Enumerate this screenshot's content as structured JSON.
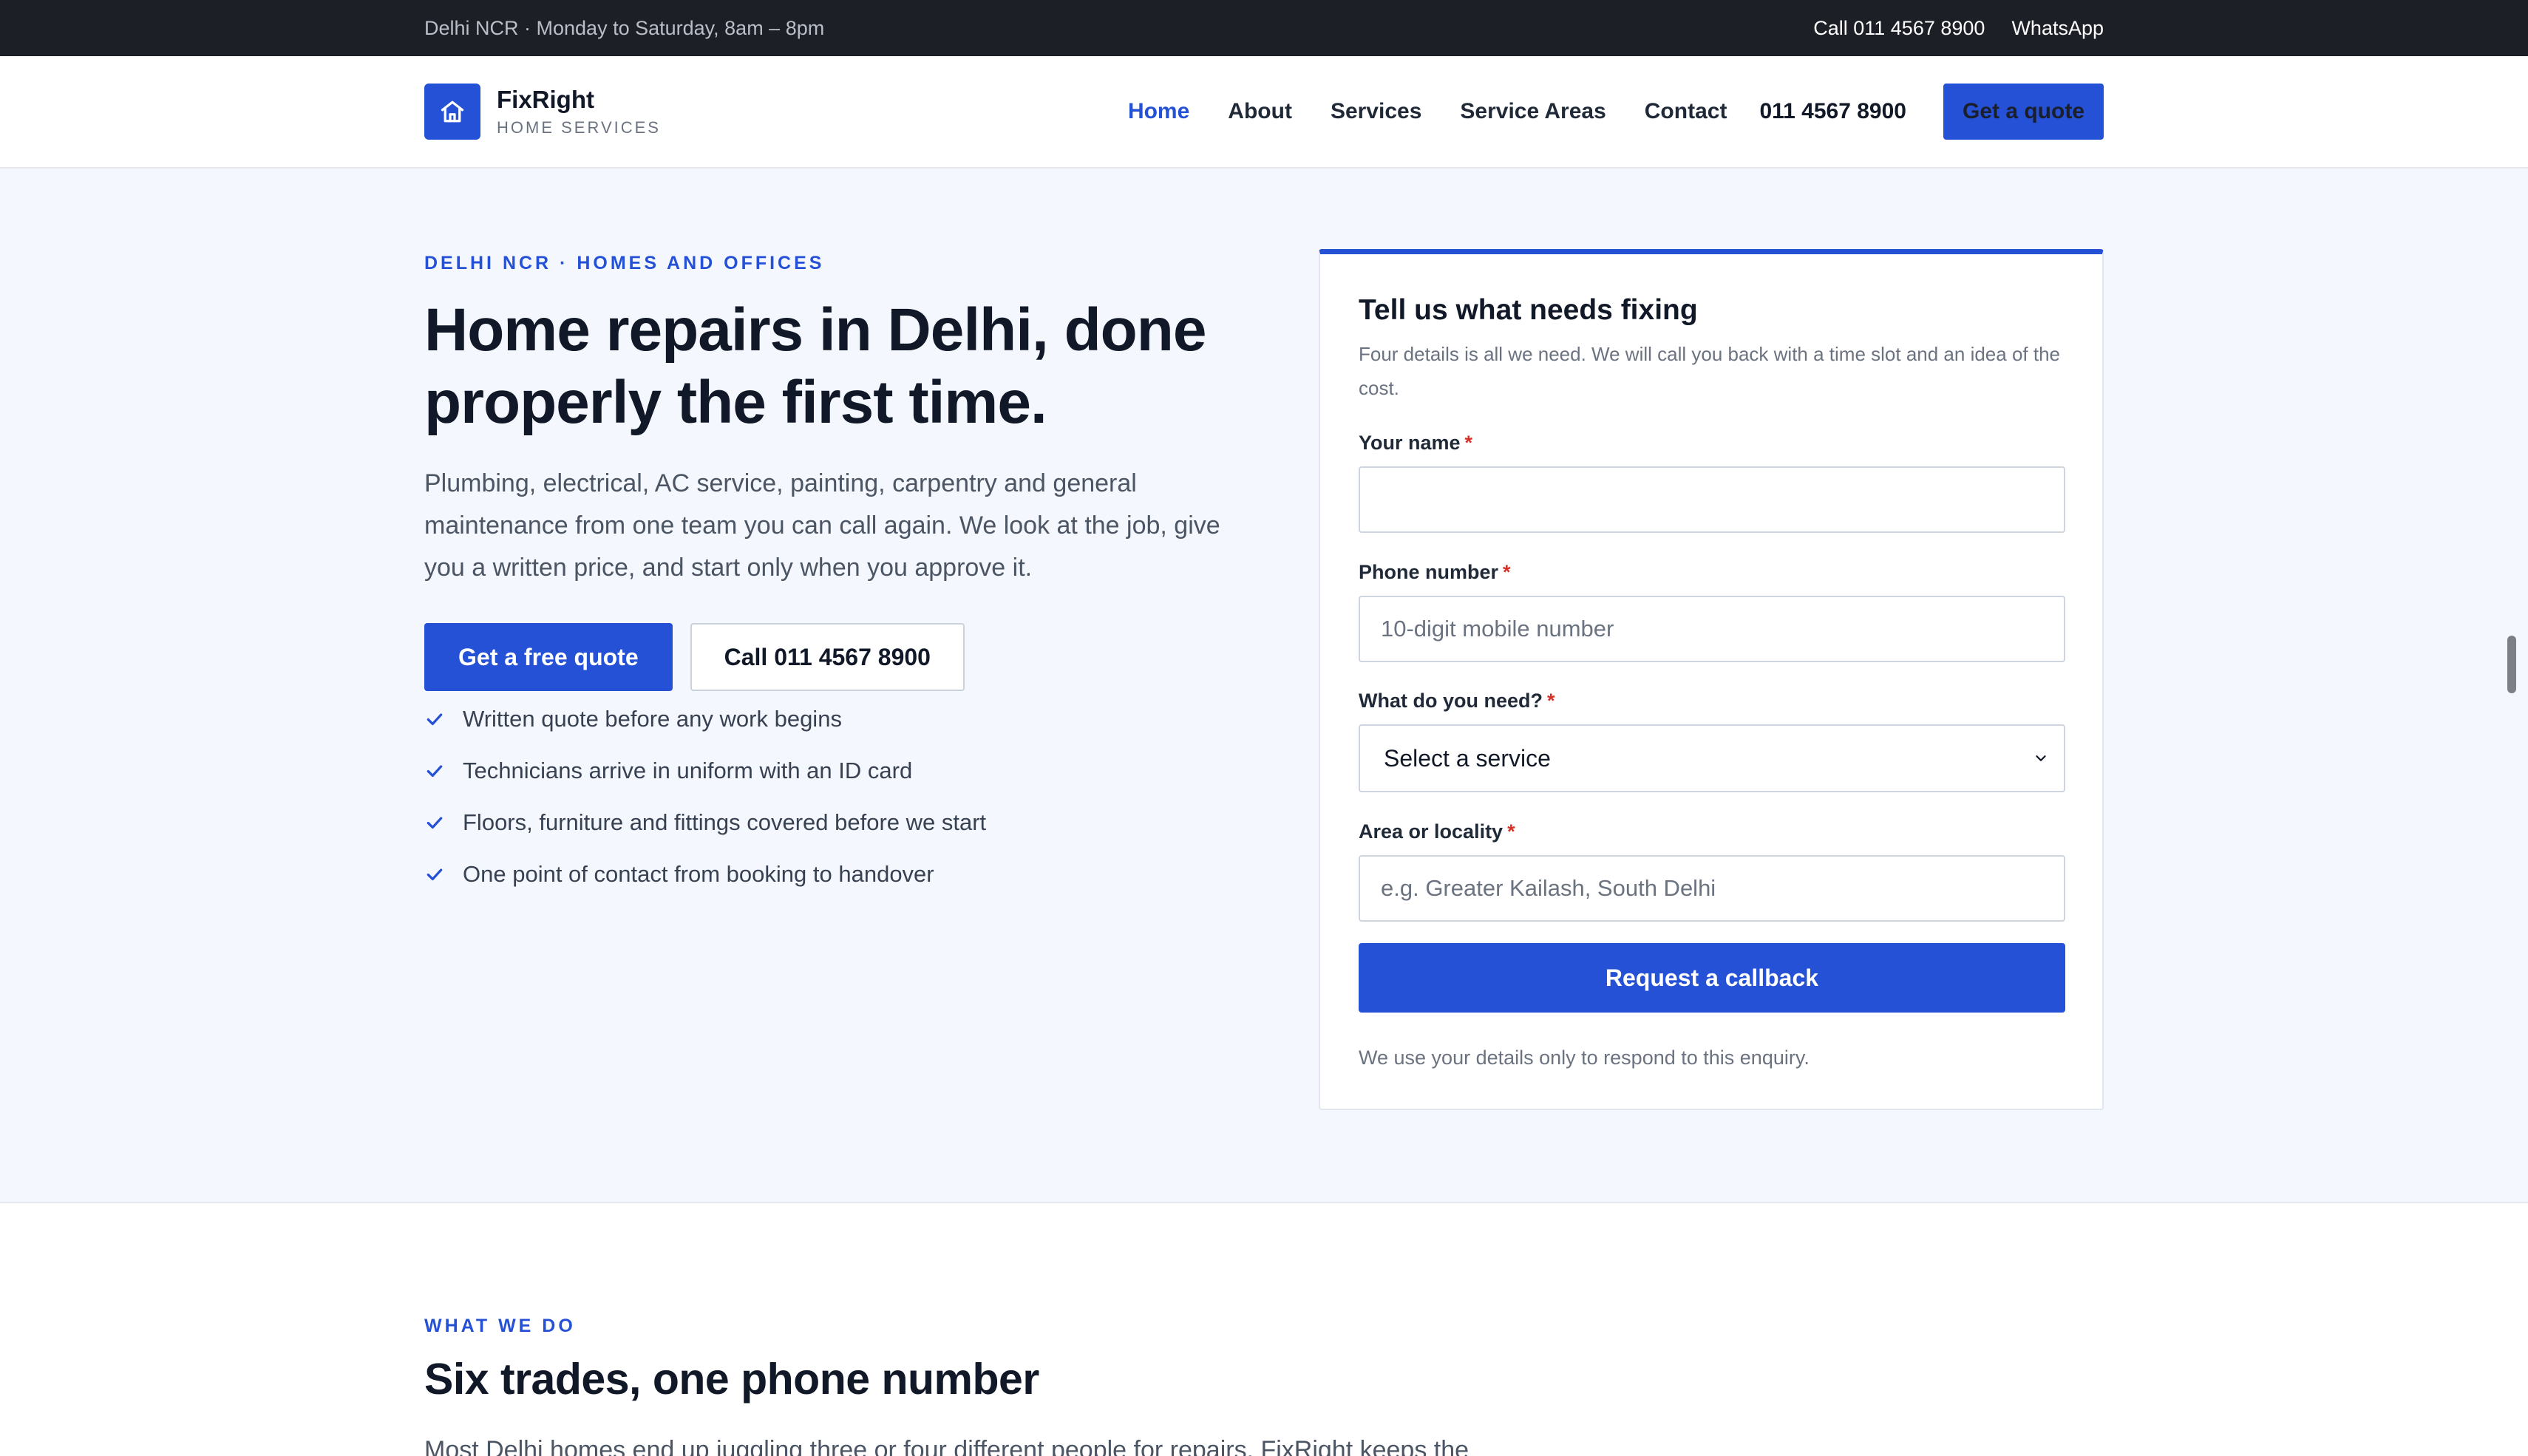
{
  "topbar": {
    "info": "Delhi NCR · Monday to Saturday, 8am – 8pm",
    "call_link": "Call 011 4567 8900",
    "whatsapp_link": "WhatsApp"
  },
  "brand": {
    "name": "FixRight",
    "tagline": "HOME SERVICES",
    "logo_icon": "house-icon",
    "accent_color": "#2451d6"
  },
  "nav": {
    "items": [
      {
        "label": "Home",
        "active": true
      },
      {
        "label": "About"
      },
      {
        "label": "Services"
      },
      {
        "label": "Service Areas"
      },
      {
        "label": "Contact"
      }
    ],
    "phone": "011 4567 8900",
    "cta": "Get a quote"
  },
  "hero": {
    "eyebrow": "DELHI NCR · HOMES AND OFFICES",
    "title": "Home repairs in Delhi, done properly the first time.",
    "description": "Plumbing, electrical, AC service, painting, carpentry and general maintenance from one team you can call again. We look at the job, give you a written price, and start only when you approve it.",
    "primary_button": "Get a free quote",
    "secondary_button": "Call 011 4567 8900",
    "checklist": [
      "Written quote before any work begins",
      "Technicians arrive in uniform with an ID card",
      "Floors, furniture and fittings covered before we start",
      "One point of contact from booking to handover"
    ]
  },
  "form": {
    "title": "Tell us what needs fixing",
    "subtitle": "Four details is all we need. We will call you back with a time slot and an idea of the cost.",
    "required_marker": "*",
    "name_label": "Your name",
    "name_value": "",
    "phone_label": "Phone number",
    "phone_placeholder": "10-digit mobile number",
    "service_label": "What do you need?",
    "service_selected": "Select a service",
    "area_label": "Area or locality",
    "area_placeholder": "e.g. Greater Kailash, South Delhi",
    "submit": "Request a callback",
    "privacy": "We use your details only to respond to this enquiry."
  },
  "section_services": {
    "eyebrow": "WHAT WE DO",
    "title": "Six trades, one phone number",
    "description": "Most Delhi homes end up juggling three or four different people for repairs. FixRight keeps the"
  }
}
